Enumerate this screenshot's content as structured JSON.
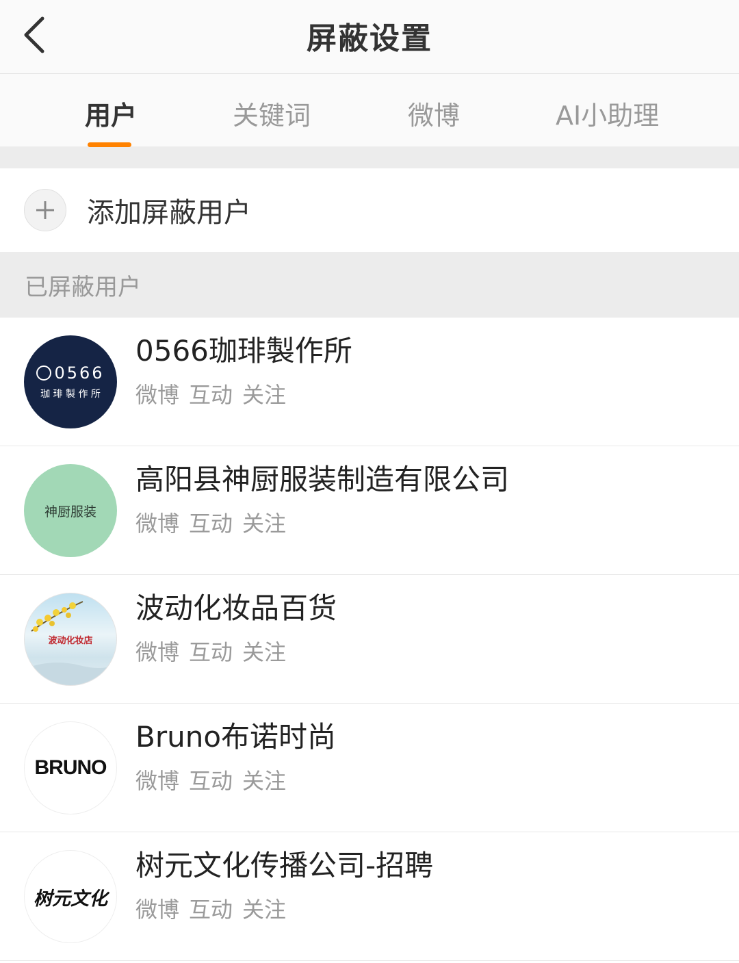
{
  "header": {
    "title": "屏蔽设置"
  },
  "tabs": [
    {
      "label": "用户"
    },
    {
      "label": "关键词"
    },
    {
      "label": "微博"
    },
    {
      "label": "AI小助理"
    }
  ],
  "add_user": {
    "label": "添加屏蔽用户"
  },
  "section": {
    "title": "已屏蔽用户"
  },
  "users": [
    {
      "name": "0566珈琲製作所",
      "tags": [
        "微博",
        "互动",
        "关注"
      ],
      "avatar_text": [
        "0566",
        "珈 琲 製 作 所"
      ],
      "avatar_color": "#152445"
    },
    {
      "name": "高阳县神厨服装制造有限公司",
      "tags": [
        "微博",
        "互动",
        "关注"
      ],
      "avatar_text": "神厨服装",
      "avatar_color": "#a2d8b6"
    },
    {
      "name": "波动化妆品百货",
      "tags": [
        "微博",
        "互动",
        "关注"
      ],
      "avatar_text": "波动化妆店",
      "avatar_color": "#d9ecf4"
    },
    {
      "name": "Bruno布诺时尚",
      "tags": [
        "微博",
        "互动",
        "关注"
      ],
      "avatar_text": "BRUNO",
      "avatar_color": "#ffffff"
    },
    {
      "name": "树元文化传播公司-招聘",
      "tags": [
        "微博",
        "互动",
        "关注"
      ],
      "avatar_text": "树元文化",
      "avatar_color": "#ffffff"
    }
  ],
  "colors": {
    "accent": "#ff8200",
    "background_gray": "#ececec"
  }
}
